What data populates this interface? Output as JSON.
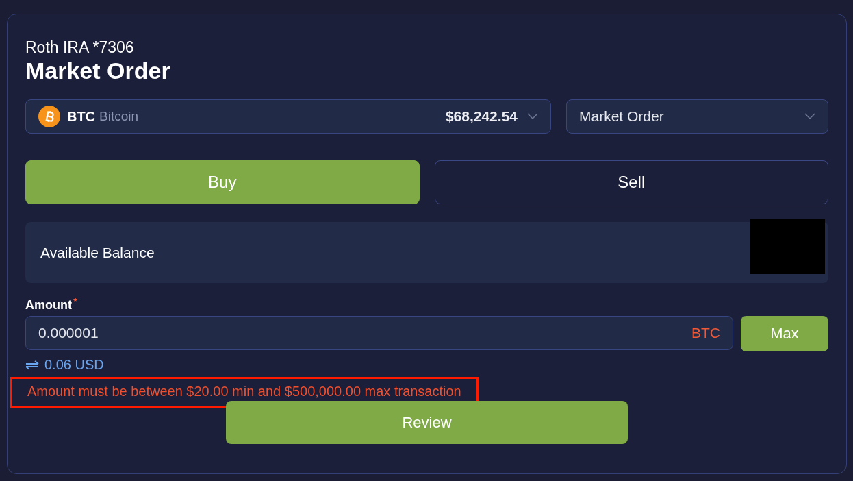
{
  "account": "Roth IRA *7306",
  "title": "Market Order",
  "asset": {
    "symbol": "BTC",
    "name": "Bitcoin",
    "price": "$68,242.54"
  },
  "order_type": {
    "value": "Market Order"
  },
  "sides": [
    {
      "label": "Buy",
      "selected": true
    },
    {
      "label": "Sell",
      "selected": false
    }
  ],
  "balance": {
    "label": "Available Balance",
    "redacted": true
  },
  "amount": {
    "label": "Amount",
    "required": "*",
    "value": "0.000001",
    "unit": "BTC",
    "max_button": "Max",
    "conversion": "0.06 USD"
  },
  "error": {
    "text": "Amount must be between $20.00 min and $500,000.00 max transaction",
    "highlighted": true
  },
  "review_button": "Review"
}
